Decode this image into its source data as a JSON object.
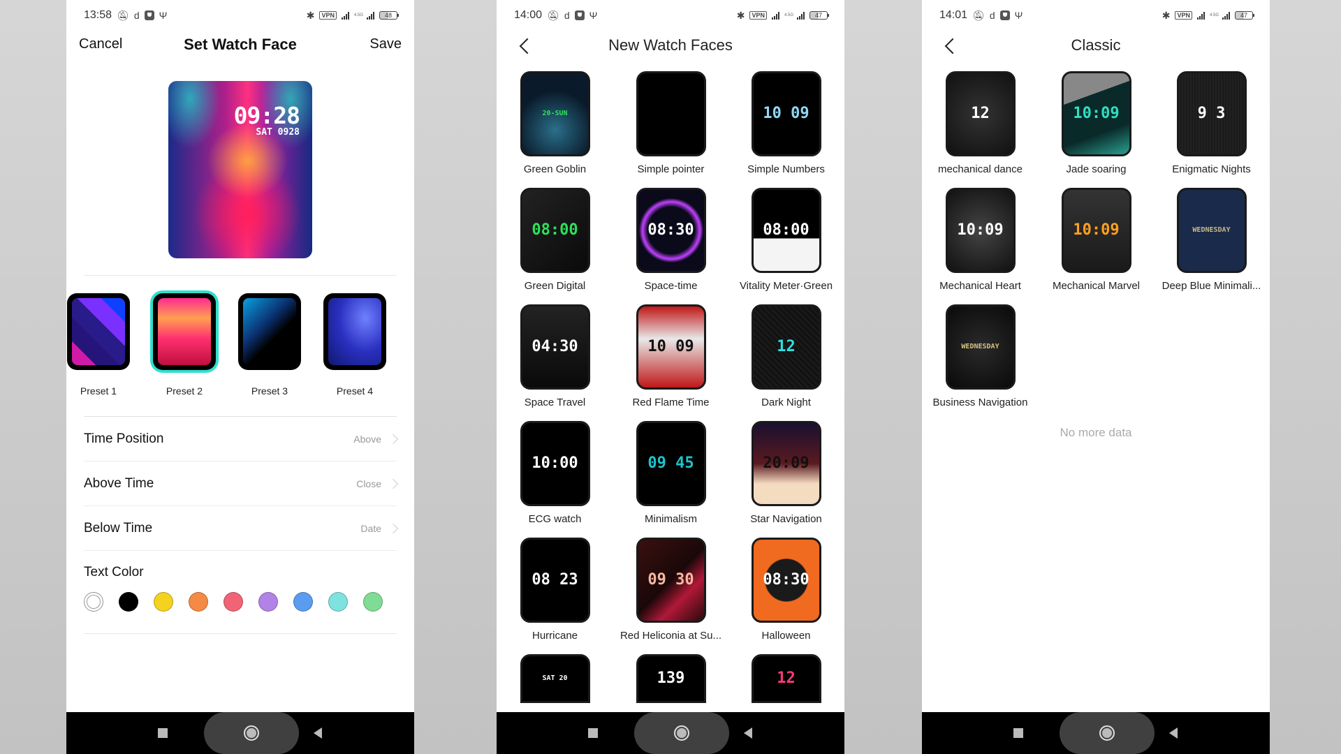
{
  "screens": [
    {
      "status": {
        "time": "13:58",
        "battery": "48",
        "network": "4.5G",
        "vpn": "VPN"
      },
      "header": {
        "cancel": "Cancel",
        "title": "Set Watch Face",
        "save": "Save"
      },
      "preview": {
        "time": "09:28",
        "date": "SAT 0928"
      },
      "presets": [
        {
          "label": "Preset 1",
          "selected": false
        },
        {
          "label": "Preset 2",
          "selected": true
        },
        {
          "label": "Preset 3",
          "selected": false
        },
        {
          "label": "Preset 4",
          "selected": false
        }
      ],
      "settings": [
        {
          "label": "Time Position",
          "value": "Above"
        },
        {
          "label": "Above Time",
          "value": "Close"
        },
        {
          "label": "Below Time",
          "value": "Date"
        }
      ],
      "text_color": {
        "label": "Text Color",
        "selected_index": 0,
        "colors": [
          "#ffffff",
          "#000000",
          "#f5d21f",
          "#f48a45",
          "#f06476",
          "#b183e6",
          "#5a9cef",
          "#7ee2de",
          "#7fdc94"
        ]
      }
    },
    {
      "status": {
        "time": "14:00",
        "battery": "47",
        "network": "4.5G",
        "vpn": "VPN"
      },
      "header": {
        "title": "New Watch Faces"
      },
      "faces": [
        {
          "name": "Green Goblin",
          "display": "20-SUN",
          "accent": "#2ee05a"
        },
        {
          "name": "Simple pointer",
          "display": "",
          "accent": "#ffffff"
        },
        {
          "name": "Simple Numbers",
          "display": "10 09",
          "accent": "#8fd8f5"
        },
        {
          "name": "Green Digital",
          "display": "08:00",
          "accent": "#2ee05a"
        },
        {
          "name": "Space-time",
          "display": "08:30",
          "accent": "#ffffff"
        },
        {
          "name": "Vitality Meter·Green",
          "display": "08:00",
          "accent": "#ffffff"
        },
        {
          "name": "Space Travel",
          "display": "04:30",
          "accent": "#ffffff"
        },
        {
          "name": "Red Flame Time",
          "display": "10 09",
          "accent": "#111111"
        },
        {
          "name": "Dark Night",
          "display": "12",
          "accent": "#2ee0e0"
        },
        {
          "name": "ECG watch",
          "display": "10:00",
          "accent": "#ffffff"
        },
        {
          "name": "Minimalism",
          "display": "09 45",
          "accent": "#1cc4cc"
        },
        {
          "name": "Star Navigation",
          "display": "20:09",
          "accent": "#111111"
        },
        {
          "name": "Hurricane",
          "display": "08 23",
          "accent": "#ffffff"
        },
        {
          "name": "Red Heliconia at Su...",
          "display": "09 30",
          "accent": "#f6b8a0"
        },
        {
          "name": "Halloween",
          "display": "08:30",
          "accent": "#ffffff"
        },
        {
          "name": "",
          "display": "SAT 20",
          "accent": "#ffffff"
        },
        {
          "name": "",
          "display": "139",
          "accent": "#ffffff"
        },
        {
          "name": "",
          "display": "12",
          "accent": "#ff3a78"
        }
      ]
    },
    {
      "status": {
        "time": "14:01",
        "battery": "47",
        "network": "4.5G",
        "vpn": "VPN"
      },
      "header": {
        "title": "Classic"
      },
      "faces": [
        {
          "name": "mechanical dance",
          "display": "12",
          "accent": "#ffffff"
        },
        {
          "name": "Jade soaring",
          "display": "10:09",
          "accent": "#2ee0c0"
        },
        {
          "name": "Enigmatic Nights",
          "display": "9  3",
          "accent": "#ffffff"
        },
        {
          "name": "Mechanical Heart",
          "display": "10:09",
          "accent": "#ffffff"
        },
        {
          "name": "Mechanical Marvel",
          "display": "10:09",
          "accent": "#ffa020"
        },
        {
          "name": "Deep Blue Minimali...",
          "display": "WEDNESDAY",
          "accent": "#c8b88a"
        },
        {
          "name": "Business Navigation",
          "display": "WEDNESDAY",
          "accent": "#d8c080"
        }
      ],
      "footer": "No more data"
    }
  ]
}
